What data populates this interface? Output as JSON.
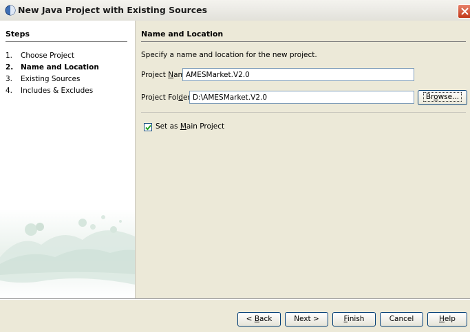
{
  "window": {
    "title": "New Java Project with Existing Sources"
  },
  "steps": {
    "heading": "Steps",
    "items": [
      {
        "num": "1.",
        "label": "Choose Project",
        "active": false
      },
      {
        "num": "2.",
        "label": "Name and Location",
        "active": true
      },
      {
        "num": "3.",
        "label": "Existing Sources",
        "active": false
      },
      {
        "num": "4.",
        "label": "Includes & Excludes",
        "active": false
      }
    ]
  },
  "main": {
    "heading": "Name and Location",
    "description": "Specify a name and location for the new project.",
    "project_name": {
      "label_pre": "Project ",
      "label_mnemonic": "N",
      "label_post": "ame:",
      "value": "AMESMarket.V2.0"
    },
    "project_folder": {
      "label_pre": "Project Fol",
      "label_mnemonic": "d",
      "label_post": "er:",
      "value": "D:\\AMESMarket.V2.0"
    },
    "browse": {
      "pre": "Br",
      "mnemonic": "o",
      "post": "wse..."
    },
    "main_project": {
      "pre": "Set as ",
      "mnemonic": "M",
      "post": "ain Project",
      "checked": true
    }
  },
  "buttons": {
    "back": {
      "pre": "< ",
      "mnemonic": "B",
      "post": "ack"
    },
    "next": "Next >",
    "finish": {
      "mnemonic": "F",
      "post": "inish"
    },
    "cancel": "Cancel",
    "help": {
      "mnemonic": "H",
      "post": "elp"
    }
  },
  "colors": {
    "accent_check": "#21a121",
    "close_button": "#c2391a"
  }
}
